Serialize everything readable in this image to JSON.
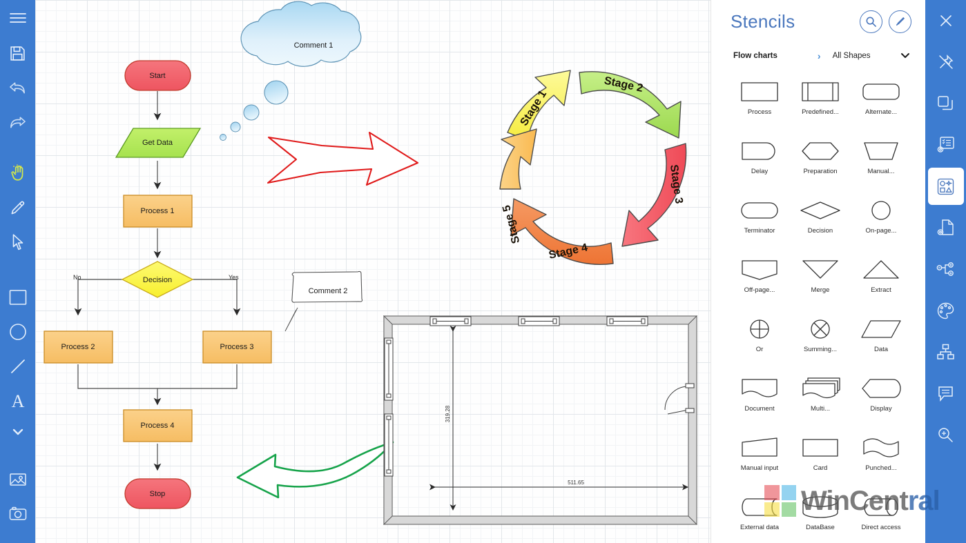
{
  "app": {
    "canvas_background": "#fefefe",
    "accent_color": "#3d7cd0",
    "panel_title_color": "#4a77bd"
  },
  "left_toolbar": {
    "items": [
      {
        "name": "menu-icon",
        "label": "Menu"
      },
      {
        "name": "save-icon",
        "label": "Save"
      },
      {
        "name": "undo-icon",
        "label": "Undo"
      },
      {
        "name": "redo-icon",
        "label": "Redo"
      },
      {
        "name": "hand-tool-icon",
        "label": "Hand",
        "active": true
      },
      {
        "name": "pen-tool-icon",
        "label": "Pen"
      },
      {
        "name": "select-tool-icon",
        "label": "Select"
      },
      {
        "name": "rectangle-tool-icon",
        "label": "Rectangle"
      },
      {
        "name": "ellipse-tool-icon",
        "label": "Ellipse"
      },
      {
        "name": "line-tool-icon",
        "label": "Line"
      },
      {
        "name": "text-tool-icon",
        "label": "Text"
      },
      {
        "name": "more-tools-chevron-icon",
        "label": "More"
      },
      {
        "name": "insert-image-icon",
        "label": "Insert image"
      },
      {
        "name": "camera-icon",
        "label": "Camera"
      }
    ]
  },
  "right_toolbar": {
    "items": [
      {
        "name": "close-icon",
        "label": "Close"
      },
      {
        "name": "unpin-icon",
        "label": "Unpin"
      },
      {
        "name": "layers-icon",
        "label": "Layers"
      },
      {
        "name": "properties-list-icon",
        "label": "Properties"
      },
      {
        "name": "shapes-panel-icon",
        "label": "Shapes",
        "active": true
      },
      {
        "name": "document-settings-icon",
        "label": "Document settings"
      },
      {
        "name": "hierarchy-icon",
        "label": "Hierarchy"
      },
      {
        "name": "palette-icon",
        "label": "Theme"
      },
      {
        "name": "org-chart-icon",
        "label": "Org chart"
      },
      {
        "name": "comment-icon",
        "label": "Comments"
      },
      {
        "name": "zoom-icon",
        "label": "Zoom"
      }
    ]
  },
  "stencils": {
    "title": "Stencils",
    "search_icon": "search-icon",
    "edit_icon": "pencil-icon",
    "breadcrumb": {
      "category": "Flow charts",
      "separator": "›",
      "filter": "All Shapes",
      "chevron": "⌄"
    },
    "shapes": [
      {
        "name": "Process",
        "glyph": "rect"
      },
      {
        "name": "Predefined...",
        "glyph": "predefined"
      },
      {
        "name": "Alternate...",
        "glyph": "roundrect"
      },
      {
        "name": "Delay",
        "glyph": "delay"
      },
      {
        "name": "Preparation",
        "glyph": "hexagon"
      },
      {
        "name": "Manual...",
        "glyph": "trapezoid-down"
      },
      {
        "name": "Terminator",
        "glyph": "stadium"
      },
      {
        "name": "Decision",
        "glyph": "diamond"
      },
      {
        "name": "On-page...",
        "glyph": "circle"
      },
      {
        "name": "Off-page...",
        "glyph": "offpage"
      },
      {
        "name": "Merge",
        "glyph": "triangle-down"
      },
      {
        "name": "Extract",
        "glyph": "triangle-up"
      },
      {
        "name": "Or",
        "glyph": "or"
      },
      {
        "name": "Summing...",
        "glyph": "summing"
      },
      {
        "name": "Data",
        "glyph": "parallelogram"
      },
      {
        "name": "Document",
        "glyph": "document"
      },
      {
        "name": "Multi...",
        "glyph": "multidoc"
      },
      {
        "name": "Display",
        "glyph": "display"
      },
      {
        "name": "Manual input",
        "glyph": "manualinput"
      },
      {
        "name": "Card",
        "glyph": "card"
      },
      {
        "name": "Punched...",
        "glyph": "punched"
      },
      {
        "name": "External data",
        "glyph": "externaldata"
      },
      {
        "name": "DataBase",
        "glyph": "database"
      },
      {
        "name": "Direct access",
        "glyph": "directaccess"
      }
    ]
  },
  "canvas": {
    "flowchart": {
      "nodes": [
        {
          "id": "start",
          "label": "Start",
          "shape": "terminator",
          "color": "#f26169"
        },
        {
          "id": "getdata",
          "label": "Get Data",
          "shape": "parallelogram",
          "color": "#b0e85a"
        },
        {
          "id": "process1",
          "label": "Process 1",
          "shape": "rect",
          "color": "#f8c471"
        },
        {
          "id": "decision",
          "label": "Decision",
          "shape": "diamond",
          "color": "#fbf040"
        },
        {
          "id": "process2",
          "label": "Process 2",
          "shape": "rect",
          "color": "#f8c471"
        },
        {
          "id": "process3",
          "label": "Process 3",
          "shape": "rect",
          "color": "#f8c471"
        },
        {
          "id": "process4",
          "label": "Process 4",
          "shape": "rect",
          "color": "#f8c471"
        },
        {
          "id": "stop",
          "label": "Stop",
          "shape": "terminator",
          "color": "#f26169"
        }
      ],
      "edge_labels": {
        "no": "No",
        "yes": "Yes"
      }
    },
    "comments": [
      {
        "id": "comment1",
        "text": "Comment 1",
        "shape": "thought-cloud"
      },
      {
        "id": "comment2",
        "text": "Comment 2",
        "shape": "speech-callout"
      }
    ],
    "cycle_diagram": {
      "stages": [
        {
          "label": "Stage 1",
          "color": "#fbf56a"
        },
        {
          "label": "Stage 2",
          "color": "#aee267"
        },
        {
          "label": "Stage 3",
          "color": "#f4616c"
        },
        {
          "label": "Stage 4",
          "color": "#f2864a"
        },
        {
          "label": "Stage 5",
          "color": "#fac56a"
        }
      ]
    },
    "floor_plan": {
      "dimension_vertical": "319.28",
      "dimension_horizontal": "511.65",
      "windows": 3,
      "doors": 1
    },
    "annotations": [
      {
        "name": "red-arrow",
        "color": "#e01b1b",
        "direction": "right"
      },
      {
        "name": "green-arrow",
        "color": "#16a34a",
        "direction": "left"
      }
    ]
  },
  "watermark": {
    "text_main": "WinCent",
    "text_tail": "ral",
    "logo_colors": [
      "#e8565f",
      "#54b9e8",
      "#f7e04a",
      "#6cc66c"
    ]
  }
}
